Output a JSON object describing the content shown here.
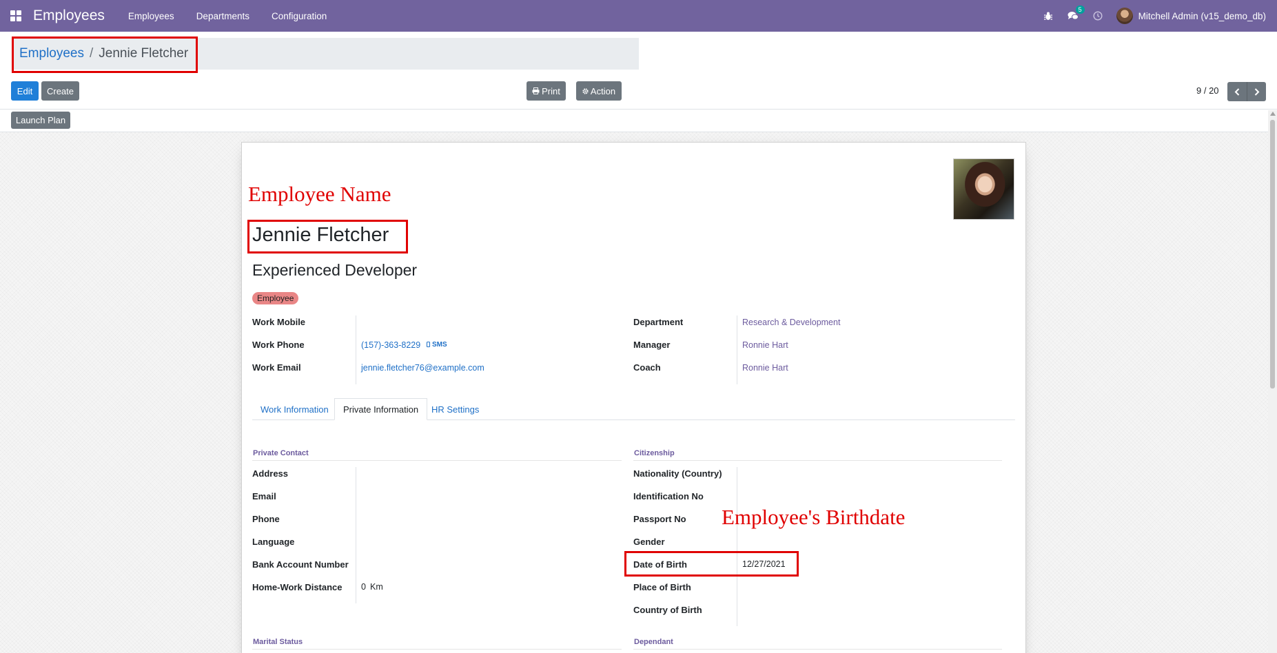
{
  "navbar": {
    "app_title": "Employees",
    "menu": [
      "Employees",
      "Departments",
      "Configuration"
    ],
    "chat_count": "5",
    "user": "Mitchell Admin (v15_demo_db)"
  },
  "breadcrumb": {
    "parent": "Employees",
    "separator": "/",
    "current": "Jennie Fletcher"
  },
  "buttons": {
    "edit": "Edit",
    "create": "Create",
    "print": "Print",
    "action": "Action",
    "launch_plan": "Launch Plan"
  },
  "pager": {
    "text": "9 / 20"
  },
  "annotations": {
    "name_note": "Employee Name",
    "birthdate_note": "Employee's Birthdate"
  },
  "employee": {
    "name": "Jennie Fletcher",
    "job_title": "Experienced Developer",
    "tag": "Employee"
  },
  "fields_left": [
    {
      "label": "Work Mobile",
      "value": ""
    },
    {
      "label": "Work Phone",
      "value": "(157)-363-8229"
    },
    {
      "label": "Work Email",
      "value": "jennie.fletcher76@example.com"
    }
  ],
  "sms_label": "SMS",
  "fields_right": [
    {
      "label": "Department",
      "value": "Research & Development"
    },
    {
      "label": "Manager",
      "value": "Ronnie Hart"
    },
    {
      "label": "Coach",
      "value": "Ronnie Hart"
    }
  ],
  "tabs": [
    "Work Information",
    "Private Information",
    "HR Settings"
  ],
  "active_tab": "Private Information",
  "private_contact": {
    "title": "Private Contact",
    "fields": [
      {
        "label": "Address",
        "value": ""
      },
      {
        "label": "Email",
        "value": ""
      },
      {
        "label": "Phone",
        "value": ""
      },
      {
        "label": "Language",
        "value": ""
      },
      {
        "label": "Bank Account Number",
        "value": ""
      },
      {
        "label": "Home-Work Distance",
        "value": "0",
        "unit": "Km"
      }
    ]
  },
  "citizenship": {
    "title": "Citizenship",
    "fields": [
      {
        "label": "Nationality (Country)",
        "value": ""
      },
      {
        "label": "Identification No",
        "value": ""
      },
      {
        "label": "Passport No",
        "value": ""
      },
      {
        "label": "Gender",
        "value": ""
      },
      {
        "label": "Date of Birth",
        "value": "12/27/2021"
      },
      {
        "label": "Place of Birth",
        "value": ""
      },
      {
        "label": "Country of Birth",
        "value": ""
      }
    ]
  },
  "bottom_groups": {
    "marital": "Marital Status",
    "dependant": "Dependant"
  },
  "colors": {
    "navbar": "#71639e",
    "primary": "#1f7fd8",
    "highlight": "#e00000",
    "tag": "#e98686"
  },
  "icons": [
    "apps-grid-icon",
    "bug-icon",
    "chat-icon",
    "clock-icon",
    "print-icon",
    "gear-icon",
    "chevron-left-icon",
    "chevron-right-icon",
    "phone-icon"
  ]
}
